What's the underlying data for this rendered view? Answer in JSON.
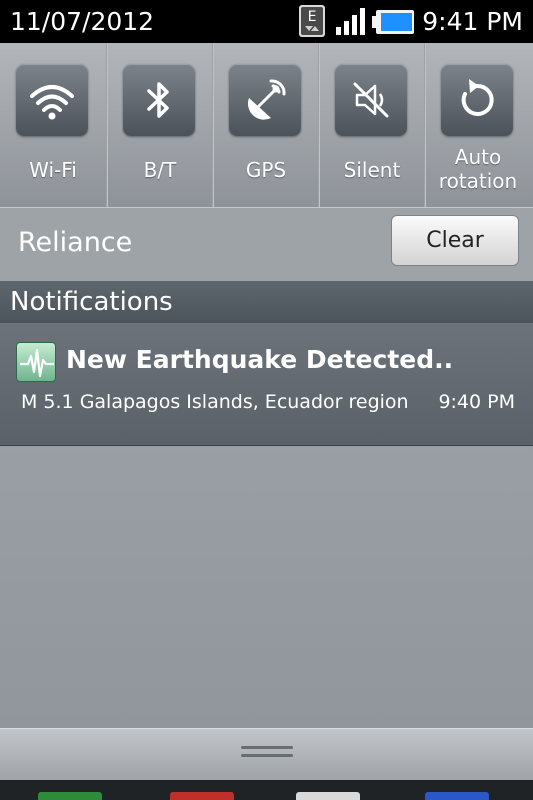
{
  "status_bar": {
    "date": "11/07/2012",
    "time": "9:41 PM",
    "network_type": "E",
    "icons": [
      "edge-data-icon",
      "signal-icon",
      "battery-icon"
    ]
  },
  "quick_settings": [
    {
      "label": "Wi-Fi",
      "icon": "wifi-icon"
    },
    {
      "label": "B/T",
      "icon": "bluetooth-icon"
    },
    {
      "label": "GPS",
      "icon": "gps-icon"
    },
    {
      "label": "Silent",
      "icon": "mute-icon"
    },
    {
      "label_line1": "Auto",
      "label_line2": "rotation",
      "icon": "rotate-icon"
    }
  ],
  "carrier": {
    "name": "Reliance",
    "clear_label": "Clear"
  },
  "notifications": {
    "header": "Notifications",
    "items": [
      {
        "title": "New Earthquake Detected..",
        "text": "M 5.1 Galapagos Islands, Ecuador region",
        "time": "9:40 PM",
        "icon": "seismograph-icon"
      }
    ]
  },
  "colors": {
    "shade_bg": "#9ea3a8",
    "notification_header_bg": "#545c64",
    "notification_item_bg": "#626970",
    "battery_fill": "#1e90ff",
    "app_icon_green": "#6fb58d"
  }
}
